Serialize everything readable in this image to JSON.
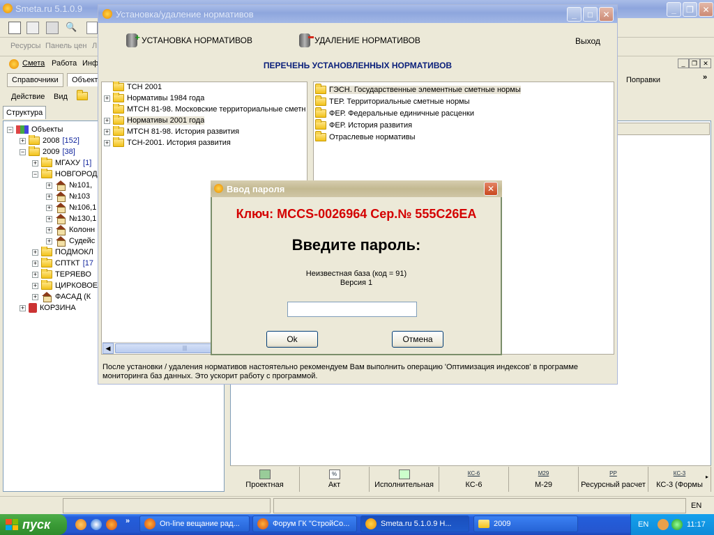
{
  "main_window": {
    "title": "Smeta.ru  5.1.0.9",
    "menu": [
      "Смета",
      "Работа",
      "Инф"
    ],
    "toolbar_row2": [
      "Ресурсы",
      "Панель цен",
      "Л"
    ],
    "tabs_row": [
      "Справочники",
      "Объект"
    ],
    "right_tabs": [
      "Поправки"
    ],
    "action_bar": [
      "Действие",
      "Вид"
    ],
    "structure_tab": "Структура",
    "tree": [
      {
        "label": "Объекты",
        "count": ""
      },
      {
        "label": "2008",
        "count": "[152]"
      },
      {
        "label": "2009",
        "count": "[38]"
      },
      {
        "label": "МГАХУ",
        "count": "[1]"
      },
      {
        "label": "НОВГОРОД",
        "count": ""
      },
      {
        "label": "№101, ",
        "count": ""
      },
      {
        "label": "№103",
        "count": ""
      },
      {
        "label": "№106,1",
        "count": ""
      },
      {
        "label": "№130,1",
        "count": ""
      },
      {
        "label": "Колонн",
        "count": ""
      },
      {
        "label": "Судейс",
        "count": ""
      },
      {
        "label": "ПОДМОКЛ",
        "count": ""
      },
      {
        "label": "СПТКТ",
        "count": "[17"
      },
      {
        "label": "ТЕРЯЕВО",
        "count": ""
      },
      {
        "label": "ЦИРКОВОЕ",
        "count": ""
      },
      {
        "label": "ФАСАД (К",
        "count": ""
      },
      {
        "label": "КОРЗИНА",
        "count": ""
      }
    ],
    "bottom_tabs": [
      {
        "icon": "",
        "label": "Проектная"
      },
      {
        "icon": "%",
        "label": "Акт"
      },
      {
        "icon": "",
        "label": "Исполнительная"
      },
      {
        "icon": "КС-6",
        "label": "КС-6"
      },
      {
        "icon": "М29",
        "label": "М-29"
      },
      {
        "icon": "РР",
        "label": "Ресурсный расчет"
      },
      {
        "icon": "КС-3",
        "label": "КС-3 (Формы"
      }
    ],
    "status_lang": "EN"
  },
  "install_window": {
    "title": "Установка/удаление нормативов",
    "install_label": "УСТАНОВКА НОРМАТИВОВ",
    "remove_label": "УДАЛЕНИЕ НОРМАТИВОВ",
    "exit_label": "Выход",
    "list_heading": "ПЕРЕЧЕНЬ УСТАНОВЛЕННЫХ НОРМАТИВОВ",
    "left_tree": [
      "ТСН 2001",
      "Нормативы 1984 года",
      "МТСН 81-98. Московские территориальные сметн",
      "Нормативы 2001 года",
      "МТСН 81-98. История развития",
      "ТСН-2001. История развития"
    ],
    "right_list": [
      "ГЭСН. Государственные элементные сметные нормы",
      "ТЕР. Территориальные сметные нормы",
      "ФЕР. Федеральные единичные расценки",
      "ФЕР. История развития",
      "Отраслевые нормативы"
    ],
    "footer_note": "После установки / удаления нормативов настоятельно рекомендуем Вам выполнить операцию 'Оптимизация индексов' в программе мониторинга баз данных. Это ускорит работу с программой."
  },
  "password_dialog": {
    "title": "Ввод пароля",
    "key_line": "Ключ:  MCCS-0026964 Сер.№ 555C26EA",
    "prompt": "Введите пароль:",
    "info_line1": "Неизвестная база (код = 91)",
    "info_line2": "Версия 1",
    "password_value": "",
    "ok_label": "Ok",
    "cancel_label": "Отмена"
  },
  "taskbar": {
    "start_label": "пуск",
    "items": [
      {
        "label": "On-line вещание рад..."
      },
      {
        "label": "Форум ГК \"СтройСо..."
      },
      {
        "label": "Smeta.ru  5.1.0.9  Н..."
      },
      {
        "label": "2009"
      }
    ],
    "tray_lang": "EN",
    "clock": "11:17"
  },
  "colors": {
    "xp_blue": "#0a3fb0",
    "heading_navy": "#0a1f7a",
    "key_red": "#d40000"
  }
}
